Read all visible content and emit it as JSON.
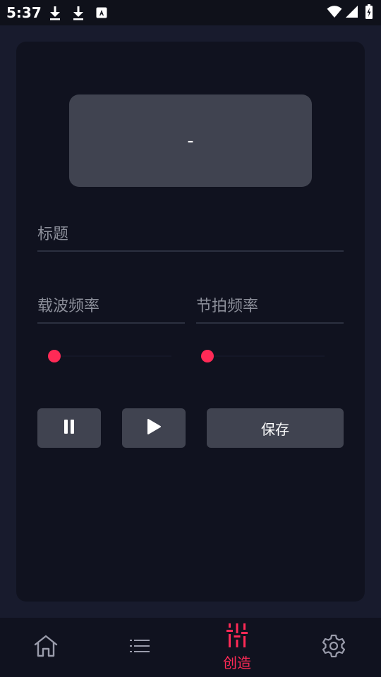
{
  "status_bar": {
    "time": "5:37",
    "icons": [
      "download-icon",
      "download-icon",
      "text-icon",
      "wifi-icon",
      "signal-icon",
      "battery-icon"
    ]
  },
  "display": {
    "text": "-"
  },
  "title_field": {
    "placeholder": "标题",
    "value": ""
  },
  "carrier_field": {
    "placeholder": "载波频率",
    "value": ""
  },
  "beat_field": {
    "placeholder": "节拍频率",
    "value": ""
  },
  "carrier_slider": {
    "value": 0
  },
  "beat_slider": {
    "value": 0
  },
  "controls": {
    "pause_icon": "pause-icon",
    "play_icon": "play-icon",
    "save_label": "保存"
  },
  "bottom_nav": {
    "items": [
      {
        "icon": "home-icon",
        "label": ""
      },
      {
        "icon": "list-icon",
        "label": ""
      },
      {
        "icon": "sliders-icon",
        "label": "创造",
        "active": true
      },
      {
        "icon": "gear-icon",
        "label": ""
      }
    ]
  },
  "colors": {
    "accent": "#ff2a56",
    "background": "#181b2d",
    "card": "#10121f",
    "button": "#404350"
  }
}
